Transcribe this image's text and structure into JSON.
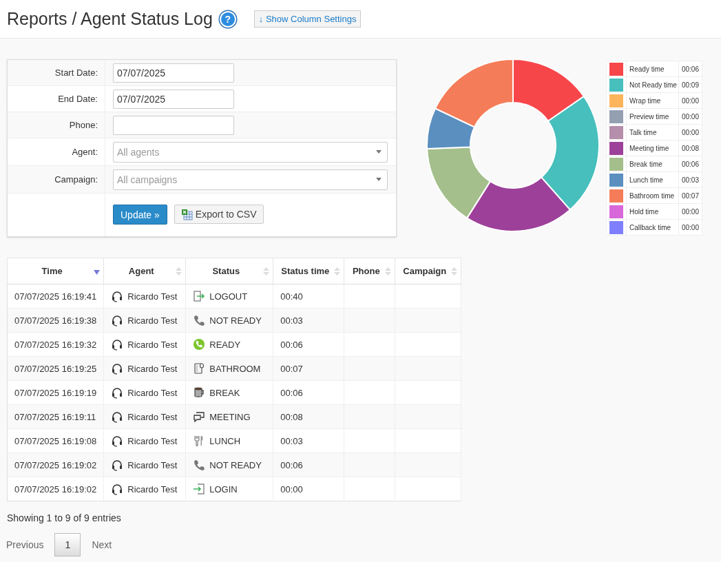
{
  "header": {
    "title": "Reports / Agent Status Log",
    "help_button": "?",
    "column_settings_button": "↓ Show Column Settings"
  },
  "filters": [
    {
      "label": "Start Date:",
      "kind": "input",
      "value": "07/07/2025"
    },
    {
      "label": "End Date:",
      "kind": "input",
      "value": "07/07/2025"
    },
    {
      "label": "Phone:",
      "kind": "input"
    },
    {
      "label": "Agent:",
      "kind": "select",
      "placeholder": "All agents"
    },
    {
      "label": "Campaign:",
      "kind": "select",
      "placeholder": "All campaigns"
    }
  ],
  "buttons": {
    "update": "Update »",
    "export": "Export to CSV"
  },
  "chart": {
    "chart_data": {
      "type": "donut",
      "categories": [
        "Ready time",
        "Not Ready time",
        "Wrap time",
        "Preview time",
        "Talk time",
        "Meeting time",
        "Break time",
        "Lunch time",
        "Bathroom time",
        "Hold time",
        "Callback time"
      ],
      "values": [
        15.38,
        23.09,
        0,
        0,
        0,
        20.51,
        15.38,
        7.69,
        17.95,
        0,
        0
      ]
    },
    "legend": [
      {
        "value": "00:06",
        "color": "#f7464a"
      },
      {
        "value": "00:09",
        "color": "#46bfbd"
      },
      {
        "value": "00:00",
        "color": "#fdb45c"
      },
      {
        "value": "00:00",
        "color": "#949fb1"
      },
      {
        "value": "00:00",
        "color": "#b48eab"
      },
      {
        "value": "00:08",
        "color": "#9d4099"
      },
      {
        "value": "00:06",
        "color": "#a4bf8c"
      },
      {
        "value": "00:03",
        "color": "#5b8fc0"
      },
      {
        "value": "00:07",
        "color": "#f57c58"
      },
      {
        "value": "00:00",
        "color": "#d868d9"
      },
      {
        "value": "00:00",
        "color": "#7f7ffe"
      }
    ]
  },
  "table": {
    "columns": [
      {
        "label": "Time",
        "sorted": true
      },
      {
        "label": "Agent",
        "sorted": false
      },
      {
        "label": "Status",
        "sorted": false
      },
      {
        "label": "Status time",
        "sorted": false
      },
      {
        "label": "Phone",
        "sorted": false
      },
      {
        "label": "Campaign",
        "sorted": false
      }
    ],
    "rows": [
      {
        "time": "07/07/2025 16:19:41",
        "agent": "Ricardo Test",
        "status": "LOGOUT",
        "kind": "logout",
        "status_time": "00:40"
      },
      {
        "time": "07/07/2025 16:19:38",
        "agent": "Ricardo Test",
        "status": "NOT READY",
        "kind": "not_ready",
        "status_time": "00:03"
      },
      {
        "time": "07/07/2025 16:19:32",
        "agent": "Ricardo Test",
        "status": "READY",
        "kind": "ready",
        "status_time": "00:06"
      },
      {
        "time": "07/07/2025 16:19:25",
        "agent": "Ricardo Test",
        "status": "BATHROOM",
        "kind": "bathroom",
        "status_time": "00:07"
      },
      {
        "time": "07/07/2025 16:19:19",
        "agent": "Ricardo Test",
        "status": "BREAK",
        "kind": "break",
        "status_time": "00:06"
      },
      {
        "time": "07/07/2025 16:19:11",
        "agent": "Ricardo Test",
        "status": "MEETING",
        "kind": "meeting",
        "status_time": "00:08"
      },
      {
        "time": "07/07/2025 16:19:08",
        "agent": "Ricardo Test",
        "status": "LUNCH",
        "kind": "lunch",
        "status_time": "00:03"
      },
      {
        "time": "07/07/2025 16:19:02",
        "agent": "Ricardo Test",
        "status": "NOT READY",
        "kind": "not_ready",
        "status_time": "00:06"
      },
      {
        "time": "07/07/2025 16:19:02",
        "agent": "Ricardo Test",
        "status": "LOGIN",
        "kind": "login",
        "status_time": "00:00"
      }
    ]
  },
  "footer": {
    "info": "Showing 1 to 9 of 9 entries",
    "pager": [
      {
        "label": "Previous",
        "kind": "nav"
      },
      {
        "label": "1",
        "kind": "page",
        "selected": true
      },
      {
        "label": "Next",
        "kind": "nav"
      }
    ]
  }
}
